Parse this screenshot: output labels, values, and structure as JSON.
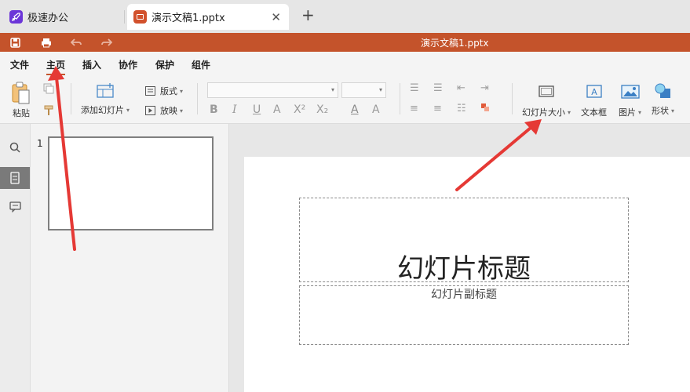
{
  "tabs": [
    {
      "label": "极速办公",
      "icon": "rocket-icon",
      "color": "#6b35d8"
    },
    {
      "label": "演示文稿1.pptx",
      "icon": "presentation-icon",
      "color": "#d2512c",
      "close": "✕"
    }
  ],
  "new_tab": "+",
  "titlebar": {
    "document_title": "演示文稿1.pptx",
    "bg_color": "#c4532b",
    "quick_access": [
      "save-icon",
      "print-icon",
      "undo-icon",
      "redo-icon"
    ]
  },
  "menu": {
    "items": [
      "文件",
      "主页",
      "插入",
      "协作",
      "保护",
      "组件"
    ],
    "active": "主页"
  },
  "ribbon": {
    "paste_label": "粘贴",
    "add_slide_label": "添加幻灯片",
    "layout_label": "版式",
    "play_label": "放映",
    "font_name_value": "",
    "font_size_value": "",
    "format_buttons": [
      "B",
      "I",
      "U",
      "A",
      "X²",
      "X₂"
    ],
    "slide_size_label": "幻灯片大小",
    "textbox_label": "文本框",
    "image_label": "图片",
    "shape_label": "形状"
  },
  "thumbnails": [
    {
      "number": "1"
    }
  ],
  "slide": {
    "title_placeholder": "幻灯片标题",
    "subtitle_placeholder": "幻灯片副标题"
  },
  "annotation_color": "#e53935"
}
